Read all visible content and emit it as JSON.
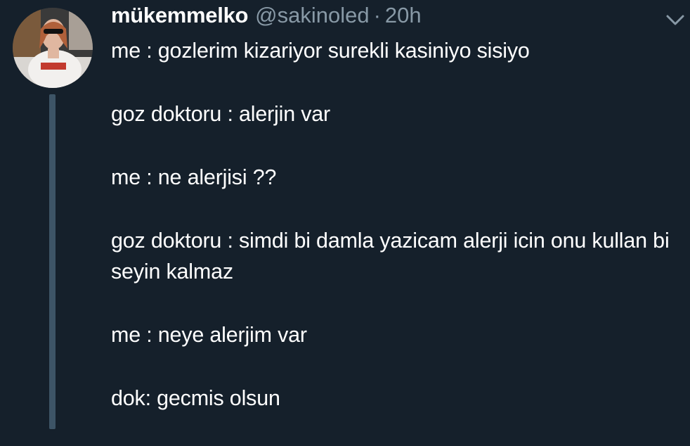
{
  "tweet": {
    "display_name": "mükemmelko",
    "handle": "@sakinoled",
    "separator": "·",
    "timestamp": "20h",
    "menu_icon": "chevron-down-icon",
    "avatar_icon": "avatar",
    "paragraphs": [
      "me : gozlerim kizariyor surekli kasiniyo sisiyo",
      "goz doktoru : alerjin var",
      "me : ne alerjisi ??",
      "goz doktoru : simdi bi damla yazicam alerji icin onu kullan bi seyin kalmaz",
      "me : neye alerjim var",
      "dok: gecmis olsun"
    ]
  },
  "colors": {
    "background": "#15202b",
    "text_primary": "#ffffff",
    "text_secondary": "#8899a6",
    "thread_line": "#3d5466"
  }
}
